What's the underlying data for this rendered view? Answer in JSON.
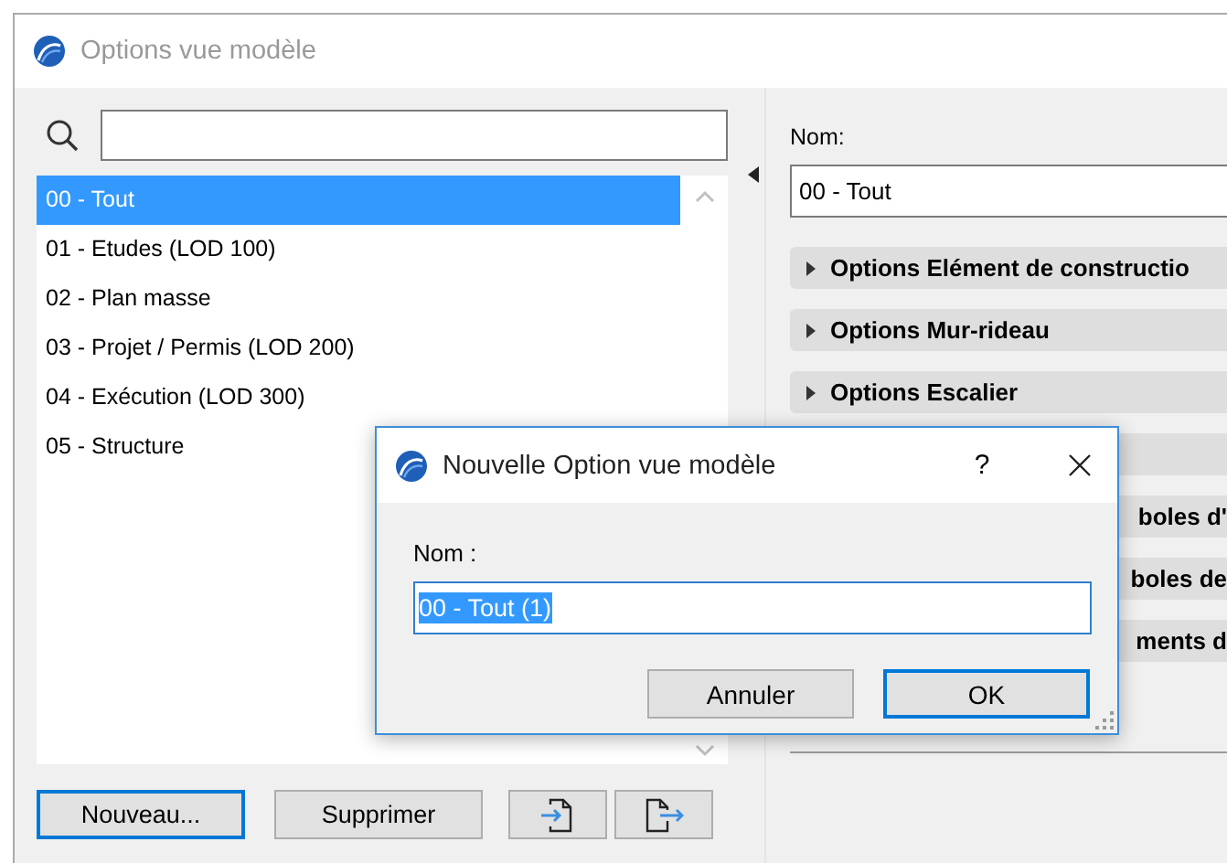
{
  "window": {
    "title": "Options vue modèle",
    "active": false
  },
  "list": {
    "items": [
      {
        "label": "00 - Tout",
        "selected": true
      },
      {
        "label": "01 - Etudes (LOD 100)",
        "selected": false
      },
      {
        "label": "02 - Plan masse",
        "selected": false
      },
      {
        "label": "03 - Projet / Permis (LOD 200)",
        "selected": false
      },
      {
        "label": "04 - Exécution (LOD 300)",
        "selected": false
      },
      {
        "label": "05 - Structure",
        "selected": false
      }
    ]
  },
  "buttons": [
    {
      "kind": "text",
      "label": "Nouveau...",
      "focused": true
    },
    {
      "kind": "text",
      "label": "Supprimer",
      "focused": false
    },
    {
      "kind": "import"
    },
    {
      "kind": "export"
    }
  ],
  "details": {
    "name_label": "Nom:",
    "name_value": "00 - Tout",
    "sections": [
      {
        "kind": "header",
        "label": "Options Elément de constructio"
      },
      {
        "kind": "header",
        "label": "Options Mur-rideau"
      },
      {
        "kind": "header",
        "label": "Options Escalier"
      },
      {
        "kind": "covered"
      },
      {
        "kind": "clipped",
        "label": "boles d'"
      },
      {
        "kind": "clipped",
        "label": "boles de"
      },
      {
        "kind": "clipped",
        "label": "ments d"
      }
    ]
  },
  "dialog": {
    "title": "Nouvelle Option vue modèle",
    "help": "?",
    "field_label": "Nom :",
    "field_value": "00 - Tout (1)",
    "value_selected": true,
    "buttons": [
      {
        "label": "Annuler",
        "focused": false
      },
      {
        "label": "OK",
        "focused": true
      }
    ]
  }
}
